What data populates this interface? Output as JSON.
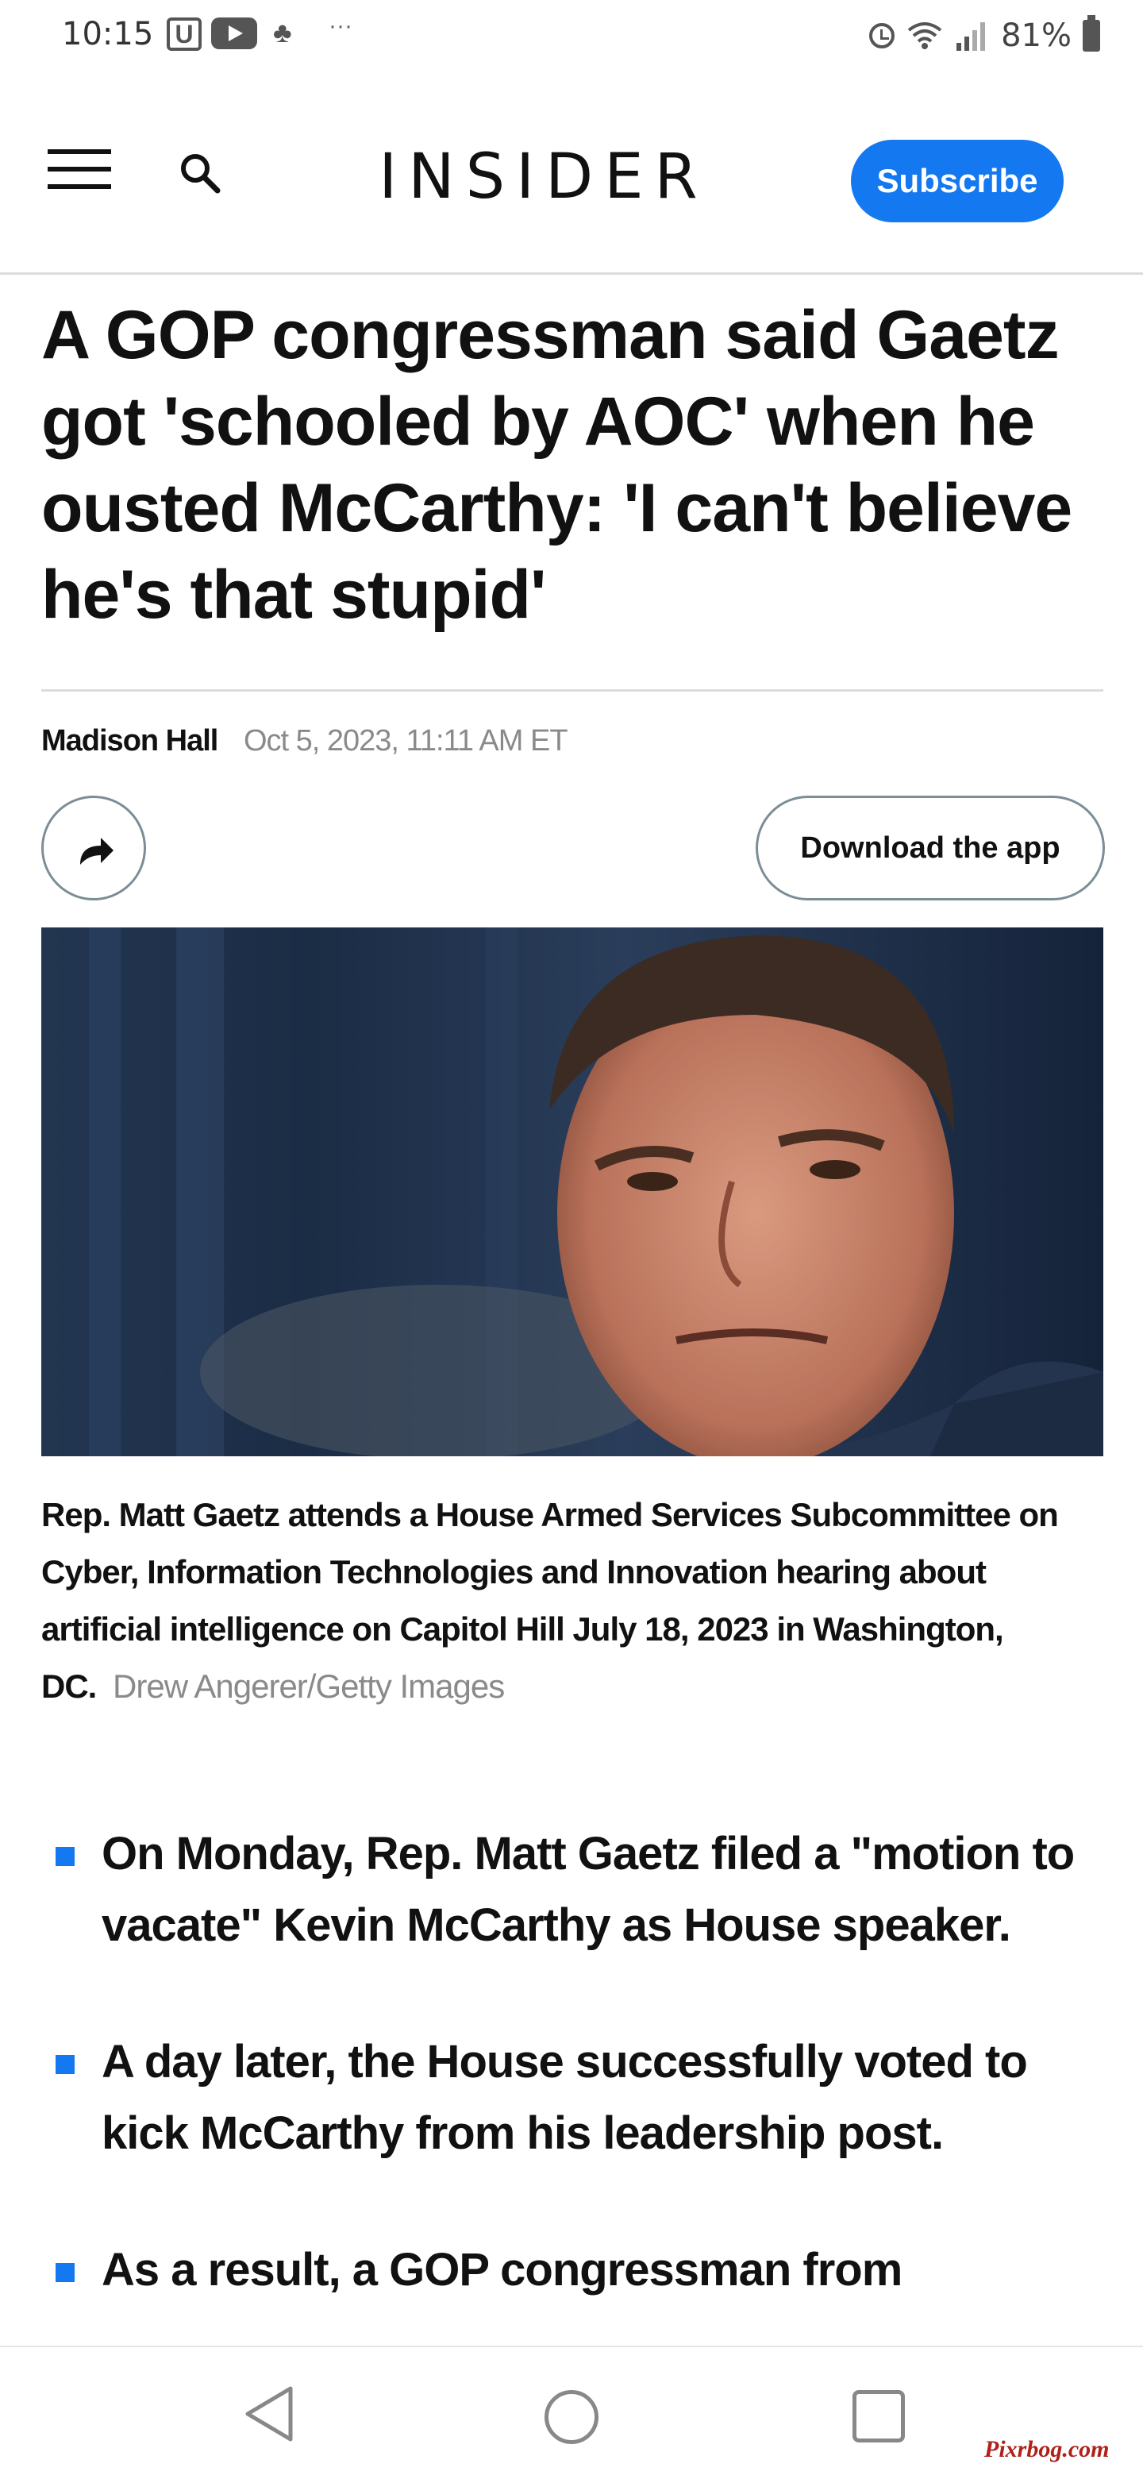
{
  "status_bar": {
    "time": "10:15",
    "battery": "81%",
    "icons": [
      "u-app-icon",
      "youtube-icon",
      "carrot-icon",
      "more-dots-icon",
      "alarm-icon",
      "wifi-icon",
      "signal-icon",
      "battery-icon"
    ]
  },
  "header": {
    "logo": "INSIDER",
    "subscribe_label": "Subscribe",
    "accent_color": "#1478f0"
  },
  "article": {
    "headline": "A GOP congressman said Gaetz got 'schooled by AOC' when he ousted McCarthy: 'I can't believe he's that stupid'",
    "author": "Madison Hall",
    "date": "Oct 5, 2023, 11:11 AM ET",
    "download_label": "Download the app",
    "caption_text": "Rep. Matt Gaetz attends a House Armed Services Subcommittee on Cyber, Information Technologies and Innovation hearing about artificial intelligence on Capitol Hill July 18, 2023 in Washington, DC.",
    "caption_credit": "Drew Angerer/Getty Images",
    "bullets": [
      "On Monday, Rep. Matt Gaetz filed a \"motion to vacate\" Kevin McCarthy as House speaker.",
      "A day later, the House successfully voted to kick McCarthy from his leadership post.",
      "As a result, a GOP congressman from"
    ]
  },
  "watermark": "Pixrbog.com"
}
